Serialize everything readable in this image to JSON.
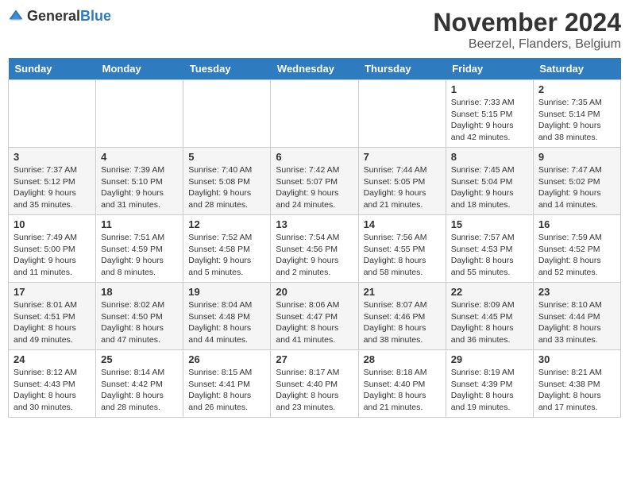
{
  "header": {
    "logo_general": "General",
    "logo_blue": "Blue",
    "month_title": "November 2024",
    "location": "Beerzel, Flanders, Belgium"
  },
  "days_of_week": [
    "Sunday",
    "Monday",
    "Tuesday",
    "Wednesday",
    "Thursday",
    "Friday",
    "Saturday"
  ],
  "weeks": [
    [
      {
        "num": "",
        "info": ""
      },
      {
        "num": "",
        "info": ""
      },
      {
        "num": "",
        "info": ""
      },
      {
        "num": "",
        "info": ""
      },
      {
        "num": "",
        "info": ""
      },
      {
        "num": "1",
        "info": "Sunrise: 7:33 AM\nSunset: 5:15 PM\nDaylight: 9 hours and 42 minutes."
      },
      {
        "num": "2",
        "info": "Sunrise: 7:35 AM\nSunset: 5:14 PM\nDaylight: 9 hours and 38 minutes."
      }
    ],
    [
      {
        "num": "3",
        "info": "Sunrise: 7:37 AM\nSunset: 5:12 PM\nDaylight: 9 hours and 35 minutes."
      },
      {
        "num": "4",
        "info": "Sunrise: 7:39 AM\nSunset: 5:10 PM\nDaylight: 9 hours and 31 minutes."
      },
      {
        "num": "5",
        "info": "Sunrise: 7:40 AM\nSunset: 5:08 PM\nDaylight: 9 hours and 28 minutes."
      },
      {
        "num": "6",
        "info": "Sunrise: 7:42 AM\nSunset: 5:07 PM\nDaylight: 9 hours and 24 minutes."
      },
      {
        "num": "7",
        "info": "Sunrise: 7:44 AM\nSunset: 5:05 PM\nDaylight: 9 hours and 21 minutes."
      },
      {
        "num": "8",
        "info": "Sunrise: 7:45 AM\nSunset: 5:04 PM\nDaylight: 9 hours and 18 minutes."
      },
      {
        "num": "9",
        "info": "Sunrise: 7:47 AM\nSunset: 5:02 PM\nDaylight: 9 hours and 14 minutes."
      }
    ],
    [
      {
        "num": "10",
        "info": "Sunrise: 7:49 AM\nSunset: 5:00 PM\nDaylight: 9 hours and 11 minutes."
      },
      {
        "num": "11",
        "info": "Sunrise: 7:51 AM\nSunset: 4:59 PM\nDaylight: 9 hours and 8 minutes."
      },
      {
        "num": "12",
        "info": "Sunrise: 7:52 AM\nSunset: 4:58 PM\nDaylight: 9 hours and 5 minutes."
      },
      {
        "num": "13",
        "info": "Sunrise: 7:54 AM\nSunset: 4:56 PM\nDaylight: 9 hours and 2 minutes."
      },
      {
        "num": "14",
        "info": "Sunrise: 7:56 AM\nSunset: 4:55 PM\nDaylight: 8 hours and 58 minutes."
      },
      {
        "num": "15",
        "info": "Sunrise: 7:57 AM\nSunset: 4:53 PM\nDaylight: 8 hours and 55 minutes."
      },
      {
        "num": "16",
        "info": "Sunrise: 7:59 AM\nSunset: 4:52 PM\nDaylight: 8 hours and 52 minutes."
      }
    ],
    [
      {
        "num": "17",
        "info": "Sunrise: 8:01 AM\nSunset: 4:51 PM\nDaylight: 8 hours and 49 minutes."
      },
      {
        "num": "18",
        "info": "Sunrise: 8:02 AM\nSunset: 4:50 PM\nDaylight: 8 hours and 47 minutes."
      },
      {
        "num": "19",
        "info": "Sunrise: 8:04 AM\nSunset: 4:48 PM\nDaylight: 8 hours and 44 minutes."
      },
      {
        "num": "20",
        "info": "Sunrise: 8:06 AM\nSunset: 4:47 PM\nDaylight: 8 hours and 41 minutes."
      },
      {
        "num": "21",
        "info": "Sunrise: 8:07 AM\nSunset: 4:46 PM\nDaylight: 8 hours and 38 minutes."
      },
      {
        "num": "22",
        "info": "Sunrise: 8:09 AM\nSunset: 4:45 PM\nDaylight: 8 hours and 36 minutes."
      },
      {
        "num": "23",
        "info": "Sunrise: 8:10 AM\nSunset: 4:44 PM\nDaylight: 8 hours and 33 minutes."
      }
    ],
    [
      {
        "num": "24",
        "info": "Sunrise: 8:12 AM\nSunset: 4:43 PM\nDaylight: 8 hours and 30 minutes."
      },
      {
        "num": "25",
        "info": "Sunrise: 8:14 AM\nSunset: 4:42 PM\nDaylight: 8 hours and 28 minutes."
      },
      {
        "num": "26",
        "info": "Sunrise: 8:15 AM\nSunset: 4:41 PM\nDaylight: 8 hours and 26 minutes."
      },
      {
        "num": "27",
        "info": "Sunrise: 8:17 AM\nSunset: 4:40 PM\nDaylight: 8 hours and 23 minutes."
      },
      {
        "num": "28",
        "info": "Sunrise: 8:18 AM\nSunset: 4:40 PM\nDaylight: 8 hours and 21 minutes."
      },
      {
        "num": "29",
        "info": "Sunrise: 8:19 AM\nSunset: 4:39 PM\nDaylight: 8 hours and 19 minutes."
      },
      {
        "num": "30",
        "info": "Sunrise: 8:21 AM\nSunset: 4:38 PM\nDaylight: 8 hours and 17 minutes."
      }
    ]
  ]
}
